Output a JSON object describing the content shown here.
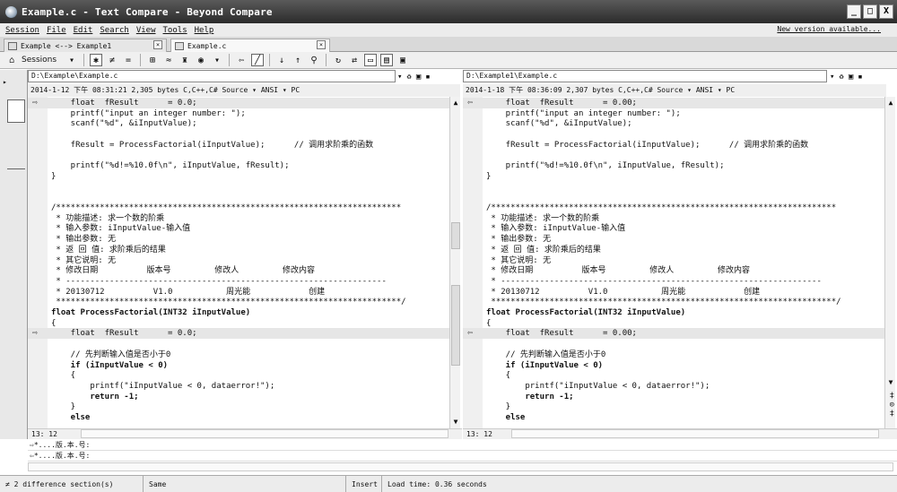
{
  "window": {
    "title": "Example.c - Text Compare - Beyond Compare",
    "buttons": [
      "_",
      "□",
      "X"
    ]
  },
  "menu": {
    "items": [
      "Session",
      "File",
      "Edit",
      "Search",
      "View",
      "Tools",
      "Help"
    ],
    "new_version": "New version available..."
  },
  "tabs": [
    {
      "label": "Example <--> Example1"
    },
    {
      "label": "Example.c"
    }
  ],
  "toolbar": {
    "sessions_label": "Sessions"
  },
  "left": {
    "path": "D:\\Example\\Example.c",
    "info": "2014-1-12 下午 08:31:21   2,305 bytes   C,C++,C# Source ▾   ANSI ▾   PC",
    "cursor": "13: 12"
  },
  "right": {
    "path": "D:\\Example1\\Example.c",
    "info": "2014-1-18 下午 08:36:09   2,307 bytes   C,C++,C# Source ▾   ANSI ▾   PC",
    "cursor": "13: 12"
  },
  "code_left": [
    {
      "t": "    float  fResult      = 0.0;",
      "diff": true
    },
    {
      "t": "    printf(\"input an integer number: \");"
    },
    {
      "t": "    scanf(\"%d\", &iInputValue);"
    },
    {
      "t": ""
    },
    {
      "t": "    fResult = ProcessFactorial(iInputValue);      // 调用求阶乘的函数"
    },
    {
      "t": ""
    },
    {
      "t": "    printf(\"%d!=%10.0f\\n\", iInputValue, fResult);"
    },
    {
      "t": "}"
    },
    {
      "t": ""
    },
    {
      "t": ""
    },
    {
      "t": "/***********************************************************************"
    },
    {
      "t": " * 功能描述: 求一个数的阶乘"
    },
    {
      "t": " * 输入参数: iInputValue-输入值"
    },
    {
      "t": " * 输出参数: 无"
    },
    {
      "t": " * 返 回 值: 求阶乘后的结果"
    },
    {
      "t": " * 其它说明: 无"
    },
    {
      "t": " * 修改日期          版本号         修改人         修改内容"
    },
    {
      "t": " * ------------------------------------------------------------------"
    },
    {
      "t": " * 20130712          V1.0           周光能            创建"
    },
    {
      "t": " ***********************************************************************/"
    },
    {
      "t": "float ProcessFactorial(INT32 iInputValue)",
      "bold": true
    },
    {
      "t": "{"
    },
    {
      "t": "    float  fResult      = 0.0;",
      "diff": true
    },
    {
      "t": ""
    },
    {
      "t": "    // 先判断输入值是否小于0"
    },
    {
      "t": "    if (iInputValue < 0)",
      "bold": true
    },
    {
      "t": "    {"
    },
    {
      "t": "        printf(\"iInputValue < 0, dataerror!\");"
    },
    {
      "t": "        return -1;",
      "bold": true
    },
    {
      "t": "    }"
    },
    {
      "t": "    else",
      "bold": true
    }
  ],
  "code_right": [
    {
      "t": "    float  fResult      = 0.00;",
      "diff": true
    },
    {
      "t": "    printf(\"input an integer number: \");"
    },
    {
      "t": "    scanf(\"%d\", &iInputValue);"
    },
    {
      "t": ""
    },
    {
      "t": "    fResult = ProcessFactorial(iInputValue);      // 调用求阶乘的函数"
    },
    {
      "t": ""
    },
    {
      "t": "    printf(\"%d!=%10.0f\\n\", iInputValue, fResult);"
    },
    {
      "t": "}"
    },
    {
      "t": ""
    },
    {
      "t": ""
    },
    {
      "t": "/***********************************************************************"
    },
    {
      "t": " * 功能描述: 求一个数的阶乘"
    },
    {
      "t": " * 输入参数: iInputValue-输入值"
    },
    {
      "t": " * 输出参数: 无"
    },
    {
      "t": " * 返 回 值: 求阶乘后的结果"
    },
    {
      "t": " * 其它说明: 无"
    },
    {
      "t": " * 修改日期          版本号         修改人         修改内容"
    },
    {
      "t": " * ------------------------------------------------------------------"
    },
    {
      "t": " * 20130712          V1.0           周光能            创建"
    },
    {
      "t": " ***********************************************************************/"
    },
    {
      "t": "float ProcessFactorial(INT32 iInputValue)",
      "bold": true
    },
    {
      "t": "{"
    },
    {
      "t": "    float  fResult      = 0.00;",
      "diff": true
    },
    {
      "t": ""
    },
    {
      "t": "    // 先判断输入值是否小于0"
    },
    {
      "t": "    if (iInputValue < 0)",
      "bold": true
    },
    {
      "t": "    {"
    },
    {
      "t": "        printf(\"iInputValue < 0, dataerror!\");"
    },
    {
      "t": "        return -1;",
      "bold": true
    },
    {
      "t": "    }"
    },
    {
      "t": "    else",
      "bold": true
    }
  ],
  "merge": {
    "line1": "⇨*....版.本.号:",
    "line2": "⇦*....版.本.号:"
  },
  "status": {
    "differences": "≠ 2 difference section(s)",
    "same": "Same",
    "mode": "Insert",
    "load_time": "Load time: 0.36 seconds"
  }
}
